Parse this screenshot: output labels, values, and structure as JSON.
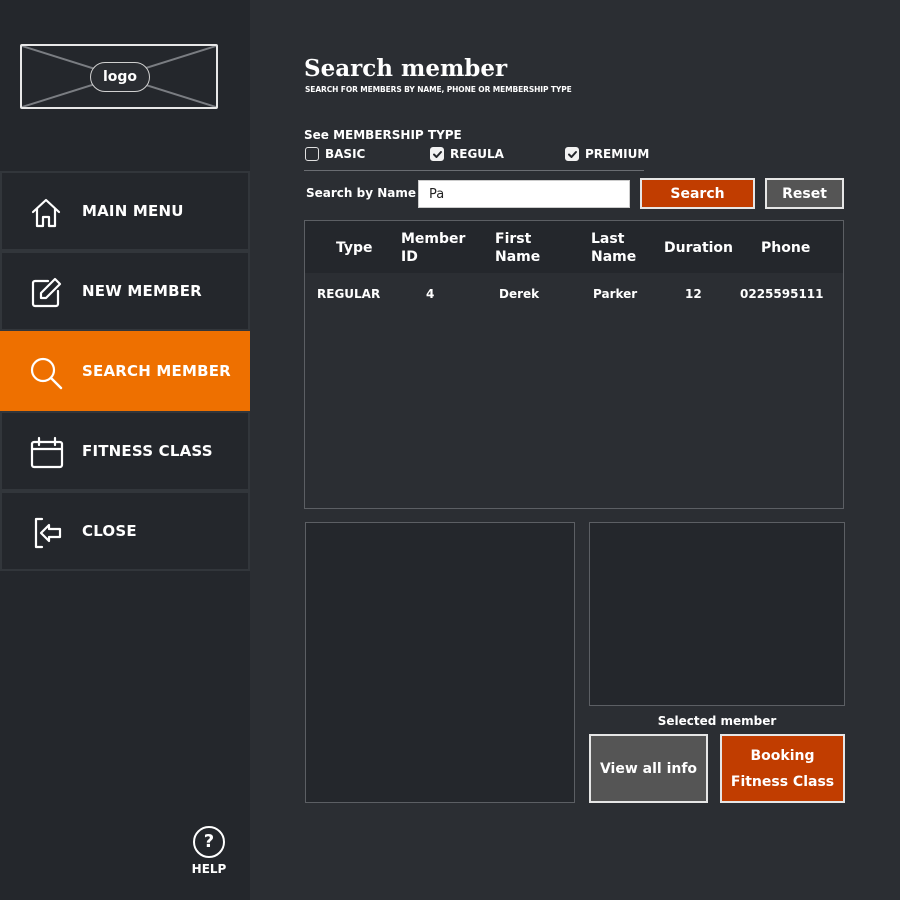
{
  "logo": {
    "text": "logo"
  },
  "sidebar": {
    "items": [
      {
        "label": "MAIN MENU",
        "icon": "home-icon"
      },
      {
        "label": "NEW MEMBER",
        "icon": "edit-icon"
      },
      {
        "label": "SEARCH MEMBER",
        "icon": "search-icon",
        "active": true
      },
      {
        "label": "FITNESS CLASS",
        "icon": "calendar-icon"
      },
      {
        "label": "CLOSE",
        "icon": "exit-icon"
      }
    ],
    "help_symbol": "?",
    "help_label": "HELP"
  },
  "header": {
    "title": "Search member",
    "subtitle": "SEARCH FOR MEMBERS BY NAME, PHONE OR MEMBERSHIP TYPE"
  },
  "filter": {
    "title": "See MEMBERSHIP TYPE",
    "options": [
      {
        "label": "BASIC",
        "checked": false
      },
      {
        "label": "REGULA",
        "checked": true
      },
      {
        "label": "PREMIUM",
        "checked": true
      }
    ]
  },
  "search": {
    "label": "Search by Name",
    "value": "Pa",
    "search_button": "Search",
    "reset_button": "Reset"
  },
  "table": {
    "columns": [
      "Type",
      "Member ID",
      "First Name",
      "Last Name",
      "Duration",
      "Phone"
    ],
    "rows": [
      {
        "type": "REGULAR",
        "member_id": "4",
        "first_name": "Derek",
        "last_name": "Parker",
        "duration": "12",
        "phone": "0225595111"
      }
    ]
  },
  "selected": {
    "label": "Selected member",
    "view_all_button": "View all info",
    "booking_button": "Booking Fitness Class"
  },
  "colors": {
    "accent_orange": "#ee7000",
    "button_red": "#c13d00",
    "button_gray": "#555555",
    "background": "#2b2e33",
    "sidebar": "#24272c"
  }
}
